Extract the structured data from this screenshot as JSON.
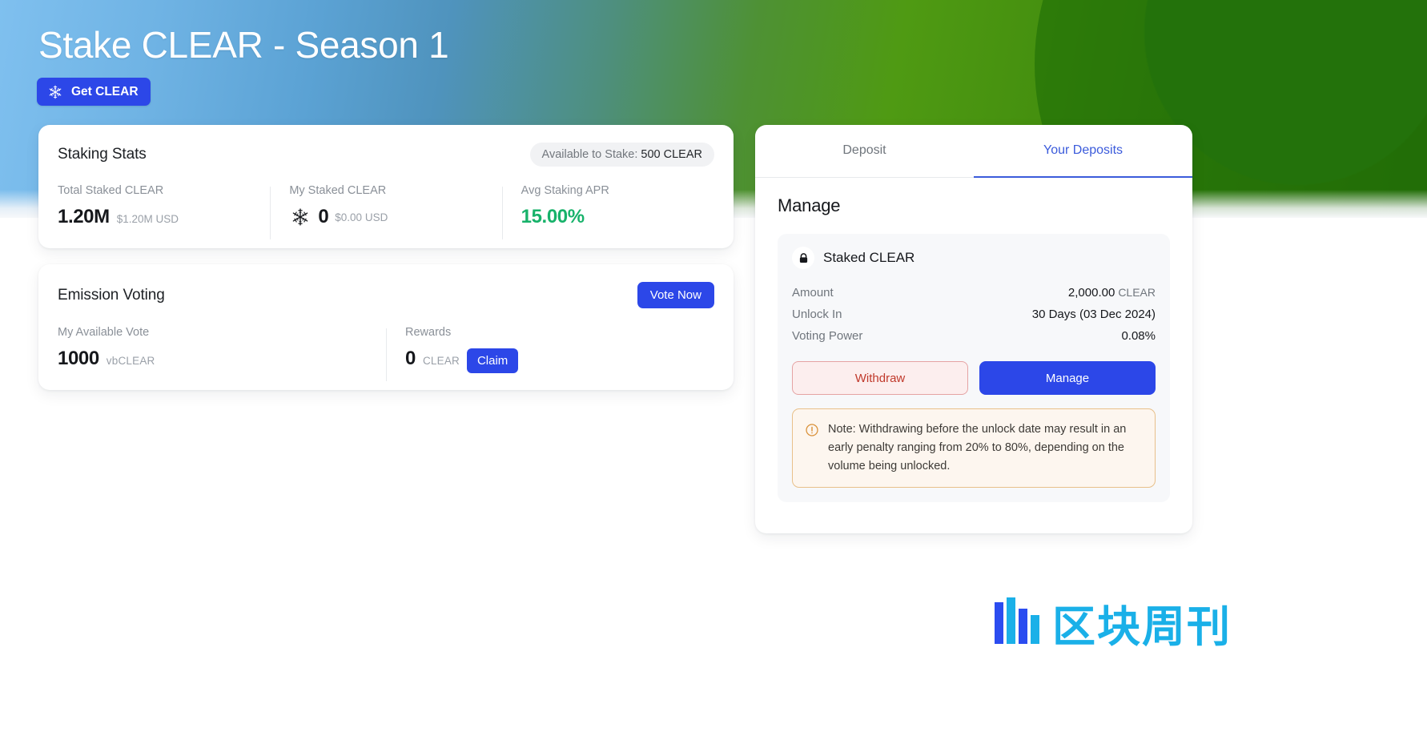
{
  "hero": {
    "title": "Stake CLEAR - Season 1",
    "get_clear_label": "Get CLEAR",
    "logo_icon": "clear-logo-icon",
    "gradient_from": "#7fc0ef",
    "gradient_to": "#2c7209",
    "accent_blue": "#2c47e8"
  },
  "staking_stats": {
    "title": "Staking Stats",
    "available_pill_label": "Available to Stake:",
    "available_pill_value": "500 CLEAR",
    "stats": [
      {
        "label": "Total Staked CLEAR",
        "value": "1.20M",
        "sub": "$1.20M USD",
        "icon": "",
        "color": "#16181c"
      },
      {
        "label": "My Staked CLEAR",
        "value": "0",
        "sub": "$0.00 USD",
        "icon": "clear-logo-icon",
        "color": "#16181c"
      },
      {
        "label": "Avg Staking APR",
        "value": "15.00%",
        "sub": "",
        "icon": "",
        "color": "#17b26a"
      }
    ]
  },
  "emission_voting": {
    "title": "Emission Voting",
    "vote_button": "Vote Now",
    "available_vote_label": "My Available Vote",
    "available_vote_value": "1000",
    "available_vote_unit": "vbCLEAR",
    "rewards_label": "Rewards",
    "rewards_value": "0",
    "rewards_unit": "CLEAR",
    "claim_button": "Claim"
  },
  "deposits_panel": {
    "tabs": [
      {
        "label": "Deposit",
        "active": false
      },
      {
        "label": "Your Deposits",
        "active": true
      }
    ],
    "heading": "Manage",
    "stake_box": {
      "lock_icon": "lock-icon",
      "title": "Staked CLEAR",
      "rows": [
        {
          "key": "Amount",
          "value": "2,000.00",
          "suffix": "CLEAR"
        },
        {
          "key": "Unlock In",
          "value": "30 Days (03 Dec 2024)",
          "suffix": ""
        },
        {
          "key": "Voting Power",
          "value": "0.08%",
          "suffix": ""
        }
      ],
      "withdraw_button": "Withdraw",
      "manage_button": "Manage",
      "note_icon": "info-circle-icon",
      "note_text": "Note: Withdrawing before the unlock date may result in an early penalty ranging from 20% to 80%, depending on the volume being unlocked."
    }
  },
  "watermark": {
    "text": "区块周刊",
    "icon": "bars-logo-icon",
    "color": "#1ab0e8"
  }
}
